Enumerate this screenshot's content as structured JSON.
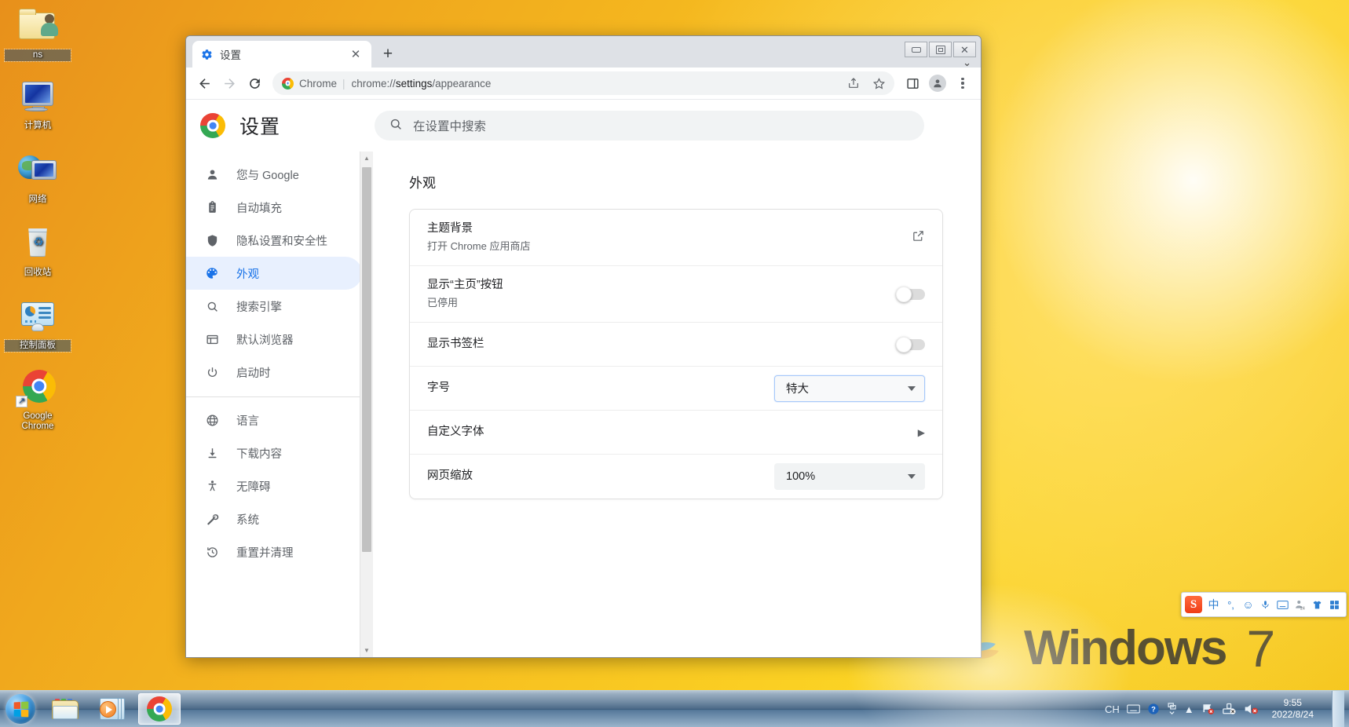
{
  "desktop": {
    "icons": [
      {
        "label": "ns",
        "icon": "user-folder-icon",
        "selected": true
      },
      {
        "label": "计算机",
        "icon": "computer-icon",
        "selected": false
      },
      {
        "label": "网络",
        "icon": "network-icon",
        "selected": false
      },
      {
        "label": "回收站",
        "icon": "recycle-bin-icon",
        "selected": false
      },
      {
        "label": "控制面板",
        "icon": "control-panel-icon",
        "selected": true
      },
      {
        "label": "Google\nChrome",
        "icon": "chrome-shortcut-icon",
        "selected": false
      }
    ],
    "watermark": {
      "brand": "Windows",
      "version": "7"
    }
  },
  "browser": {
    "tab": {
      "title": "设置",
      "favicon": "settings-gear-icon",
      "close_label": "✕"
    },
    "new_tab_label": "+",
    "tab_list_chevron": "⌄",
    "window_controls": {
      "minimize": "最小化",
      "maximize": "最大化",
      "close": "✕"
    },
    "toolbar": {
      "back": "←",
      "forward": "→",
      "reload": "⟳",
      "site_chip": "Chrome",
      "separator": "|",
      "url_prefix": "chrome://",
      "url_bold": "settings",
      "url_suffix": "/appearance",
      "share": "share-icon",
      "bookmark": "star-icon",
      "side_panel": "side-panel-icon",
      "profile": "profile-avatar",
      "menu": "three-dot-menu"
    }
  },
  "settings": {
    "title": "设置",
    "search_placeholder": "在设置中搜索",
    "nav": {
      "group1": [
        {
          "label": "您与 Google",
          "icon": "person-icon",
          "active": false
        },
        {
          "label": "自动填充",
          "icon": "clipboard-icon",
          "active": false
        },
        {
          "label": "隐私设置和安全性",
          "icon": "shield-icon",
          "active": false
        },
        {
          "label": "外观",
          "icon": "palette-icon",
          "active": true
        },
        {
          "label": "搜索引擎",
          "icon": "search-icon",
          "active": false
        },
        {
          "label": "默认浏览器",
          "icon": "browser-window-icon",
          "active": false
        },
        {
          "label": "启动时",
          "icon": "power-icon",
          "active": false
        }
      ],
      "group2": [
        {
          "label": "语言",
          "icon": "globe-icon",
          "active": false
        },
        {
          "label": "下载内容",
          "icon": "download-icon",
          "active": false
        },
        {
          "label": "无障碍",
          "icon": "accessibility-icon",
          "active": false
        },
        {
          "label": "系统",
          "icon": "wrench-icon",
          "active": false
        },
        {
          "label": "重置并清理",
          "icon": "restore-icon",
          "active": false
        }
      ]
    },
    "section_title": "外观",
    "rows": [
      {
        "name": "theme",
        "title": "主题背景",
        "sub": "打开 Chrome 应用商店",
        "control": "external-link"
      },
      {
        "name": "show-home-button",
        "title": "显示“主页”按钮",
        "sub": "已停用",
        "control": "toggle",
        "toggle_on": false
      },
      {
        "name": "show-bookmarks-bar",
        "title": "显示书签栏",
        "sub": "",
        "control": "toggle",
        "toggle_on": false
      },
      {
        "name": "font-size",
        "title": "字号",
        "sub": "",
        "control": "select",
        "value": "特大",
        "focused": true
      },
      {
        "name": "customize-fonts",
        "title": "自定义字体",
        "sub": "",
        "control": "chevron"
      },
      {
        "name": "page-zoom",
        "title": "网页缩放",
        "sub": "",
        "control": "select",
        "value": "100%",
        "focused": false
      }
    ]
  },
  "ime": {
    "name": "sogou-input-toolbar",
    "logo": "S",
    "items": [
      "中",
      "°,",
      "☺",
      "🎤",
      "⌨",
      "24",
      "👕",
      "▦"
    ]
  },
  "taskbar": {
    "start_label": "开始",
    "tasks": [
      {
        "name": "file-explorer",
        "active": false
      },
      {
        "name": "media-player",
        "active": false
      },
      {
        "name": "google-chrome",
        "active": true
      }
    ],
    "tray": {
      "language": "CH",
      "icons": [
        "keyboard-icon",
        "help-icon",
        "show-hidden-icon",
        "network-error-icon",
        "removable-media-icon",
        "volume-muted-icon"
      ],
      "time": "9:55",
      "date": "2022/8/24"
    }
  }
}
